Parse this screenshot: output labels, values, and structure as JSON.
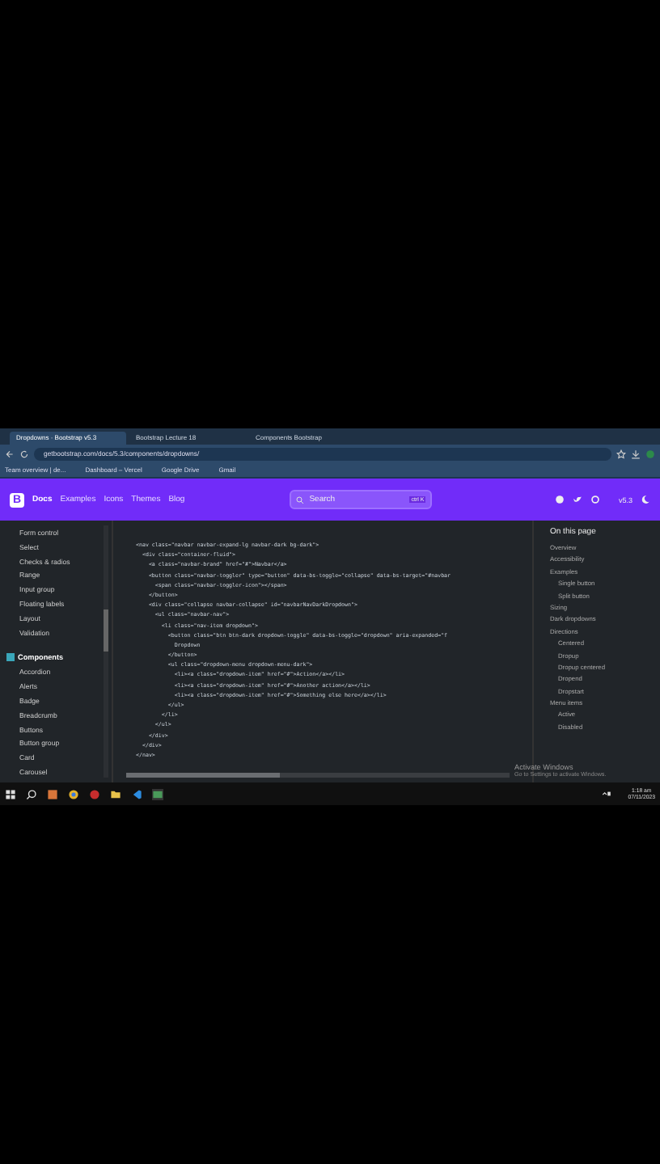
{
  "browser": {
    "tabs": [
      {
        "label": "Dropdowns · Bootstrap v5.3",
        "selected": true
      },
      {
        "label": "Bootstrap Lecture 18",
        "selected": false
      },
      {
        "label": "Components Bootstrap",
        "selected": false
      }
    ],
    "address": "getbootstrap.com/docs/5.3/components/dropdowns/",
    "bookmarks": [
      "Team overview | de...",
      "Dashboard – Vercel",
      "Google Drive",
      "Gmail"
    ]
  },
  "navbar": {
    "logo": "B",
    "links": [
      "Docs",
      "Examples",
      "Icons",
      "Themes",
      "Blog"
    ],
    "search": {
      "placeholder": "Search",
      "shortcut": "ctrl K"
    },
    "version": "v5.3"
  },
  "sidebar": {
    "items": [
      {
        "label": "Form control",
        "kind": "link"
      },
      {
        "label": "Select",
        "kind": "link"
      },
      {
        "label": "Checks & radios",
        "kind": "link"
      },
      {
        "label": "Range",
        "kind": "link"
      },
      {
        "label": "Input group",
        "kind": "link"
      },
      {
        "label": "Floating labels",
        "kind": "link"
      },
      {
        "label": "Layout",
        "kind": "link"
      },
      {
        "label": "Validation",
        "kind": "link"
      },
      {
        "label": "Components",
        "kind": "heading"
      },
      {
        "label": "Accordion",
        "kind": "link"
      },
      {
        "label": "Alerts",
        "kind": "link"
      },
      {
        "label": "Badge",
        "kind": "link"
      },
      {
        "label": "Breadcrumb",
        "kind": "link"
      },
      {
        "label": "Buttons",
        "kind": "link"
      },
      {
        "label": "Button group",
        "kind": "link"
      },
      {
        "label": "Card",
        "kind": "link"
      },
      {
        "label": "Carousel",
        "kind": "link"
      }
    ]
  },
  "code": [
    "<nav class=\"navbar navbar-expand-lg navbar-dark bg-dark\">",
    "  <div class=\"container-fluid\">",
    "    <a class=\"navbar-brand\" href=\"#\">Navbar</a>",
    "    <button class=\"navbar-toggler\" type=\"button\" data-bs-toggle=\"collapse\" data-bs-target=\"#navbar",
    "      <span class=\"navbar-toggler-icon\"></span>",
    "    </button>",
    "    <div class=\"collapse navbar-collapse\" id=\"navbarNavDarkDropdown\">",
    "      <ul class=\"navbar-nav\">",
    "        <li class=\"nav-item dropdown\">",
    "          <button class=\"btn btn-dark dropdown-toggle\" data-bs-toggle=\"dropdown\" aria-expanded=\"f",
    "            Dropdown",
    "          </button>",
    "          <ul class=\"dropdown-menu dropdown-menu-dark\">",
    "            <li><a class=\"dropdown-item\" href=\"#\">Action</a></li>",
    "            <li><a class=\"dropdown-item\" href=\"#\">Another action</a></li>",
    "            <li><a class=\"dropdown-item\" href=\"#\">Something else here</a></li>",
    "          </ul>",
    "        </li>",
    "      </ul>",
    "    </div>",
    "  </div>",
    "</nav>"
  ],
  "toc": {
    "title": "On this page",
    "items": [
      {
        "label": "Overview"
      },
      {
        "label": "Accessibility"
      },
      {
        "label": "Examples",
        "children": [
          {
            "label": "Single button"
          },
          {
            "label": "Split button"
          }
        ]
      },
      {
        "label": "Sizing"
      },
      {
        "label": "Dark dropdowns"
      },
      {
        "label": "Directions",
        "children": [
          {
            "label": "Centered"
          },
          {
            "label": "Dropup"
          },
          {
            "label": "Dropup centered"
          },
          {
            "label": "Dropend"
          },
          {
            "label": "Dropstart"
          }
        ]
      },
      {
        "label": "Menu items",
        "children": [
          {
            "label": "Active"
          },
          {
            "label": "Disabled"
          }
        ]
      }
    ]
  },
  "activation": [
    "Activate Windows",
    "Go to Settings to activate Windows."
  ],
  "taskbar": {
    "time": "1:18 am",
    "date": "07/11/2023"
  }
}
